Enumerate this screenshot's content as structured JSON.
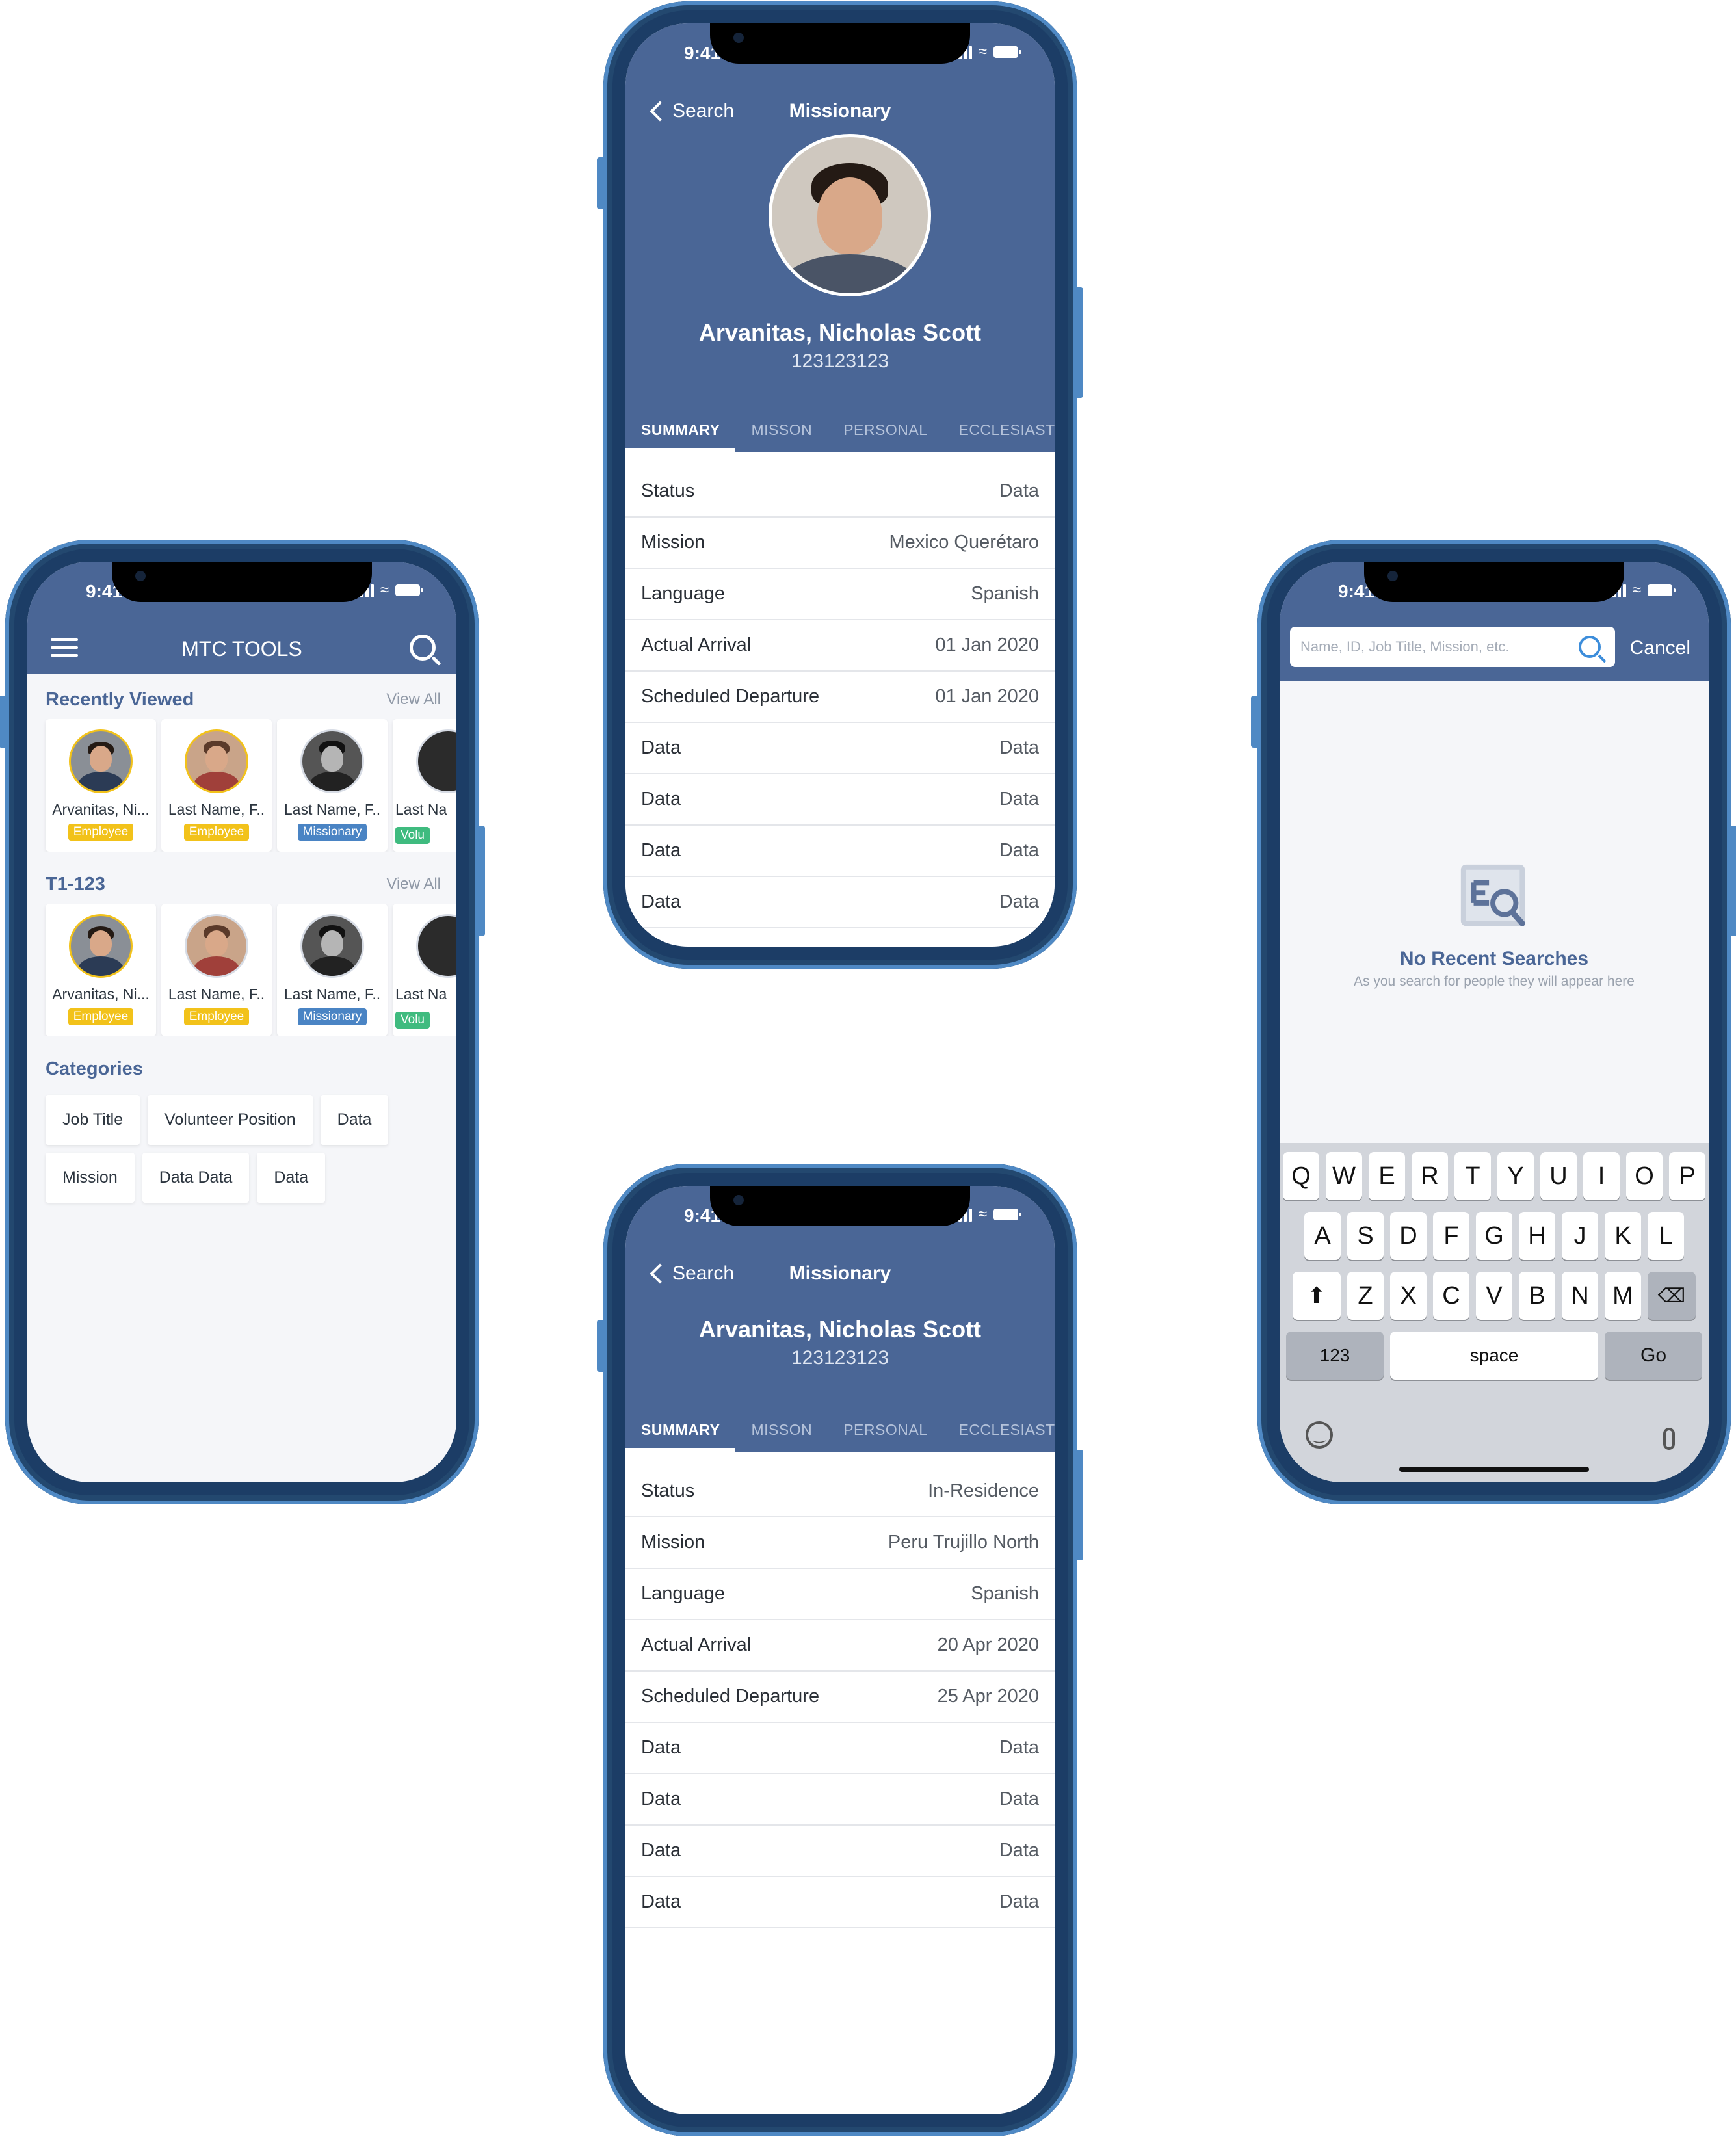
{
  "status": {
    "time": "9:41"
  },
  "colors": {
    "nav_blue": "#4a6696",
    "employee": "#f2c21a",
    "missionary": "#4a84c4",
    "volunteer": "#3fbb7f",
    "search_accent": "#3c8ddb"
  },
  "home": {
    "title": "MTC TOOLS",
    "recent": {
      "title": "Recently Viewed",
      "view_all": "View All",
      "cards": [
        {
          "name": "Arvanitas, Ni...",
          "badge": "Employee"
        },
        {
          "name": "Last Name, F..",
          "badge": "Employee"
        },
        {
          "name": "Last Name, F..",
          "badge": "Missionary"
        },
        {
          "name": "Last Na",
          "badge": "Volu"
        }
      ]
    },
    "group": {
      "title": "T1-123",
      "view_all": "View All",
      "cards": [
        {
          "name": "Arvanitas, Ni...",
          "badge": "Employee"
        },
        {
          "name": "Last Name, F..",
          "badge": "Employee"
        },
        {
          "name": "Last Name, F..",
          "badge": "Missionary"
        },
        {
          "name": "Last Na",
          "badge": "Volu"
        }
      ]
    },
    "categories": {
      "title": "Categories",
      "items": [
        "Job Title",
        "Volunteer Position",
        "Data",
        "Mission",
        "Data Data",
        "Data"
      ]
    }
  },
  "detail_a": {
    "back": "Search",
    "title": "Missionary",
    "name": "Arvanitas, Nicholas Scott",
    "id": "123123123",
    "tabs": [
      "SUMMARY",
      "MISSON",
      "PERSONAL",
      "ECCLESIASTI"
    ],
    "rows": [
      {
        "label": "Status",
        "value": "Data"
      },
      {
        "label": "Mission",
        "value": "Mexico Querétaro"
      },
      {
        "label": "Language",
        "value": "Spanish"
      },
      {
        "label": "Actual Arrival",
        "value": "01 Jan 2020"
      },
      {
        "label": "Scheduled Departure",
        "value": "01 Jan 2020"
      },
      {
        "label": "Data",
        "value": "Data"
      },
      {
        "label": "Data",
        "value": "Data"
      },
      {
        "label": "Data",
        "value": "Data"
      },
      {
        "label": "Data",
        "value": "Data"
      }
    ]
  },
  "detail_b": {
    "back": "Search",
    "title": "Missionary",
    "name": "Arvanitas, Nicholas Scott",
    "id": "123123123",
    "tabs": [
      "SUMMARY",
      "MISSON",
      "PERSONAL",
      "ECCLESIAST"
    ],
    "rows": [
      {
        "label": "Status",
        "value": "In-Residence"
      },
      {
        "label": "Mission",
        "value": "Peru Trujillo North"
      },
      {
        "label": "Language",
        "value": "Spanish"
      },
      {
        "label": "Actual Arrival",
        "value": "20 Apr 2020"
      },
      {
        "label": "Scheduled Departure",
        "value": "25 Apr 2020"
      },
      {
        "label": "Data",
        "value": "Data"
      },
      {
        "label": "Data",
        "value": "Data"
      },
      {
        "label": "Data",
        "value": "Data"
      },
      {
        "label": "Data",
        "value": "Data"
      }
    ]
  },
  "search": {
    "placeholder": "Name, ID, Job Title, Mission, etc.",
    "cancel": "Cancel",
    "empty_title": "No Recent Searches",
    "empty_sub": "As you search for people they will appear here",
    "keyboard": {
      "row1": [
        "Q",
        "W",
        "E",
        "R",
        "T",
        "Y",
        "U",
        "I",
        "O",
        "P"
      ],
      "row2": [
        "A",
        "S",
        "D",
        "F",
        "G",
        "H",
        "J",
        "K",
        "L"
      ],
      "row3": [
        "Z",
        "X",
        "C",
        "V",
        "B",
        "N",
        "M"
      ],
      "numbers": "123",
      "space": "space",
      "go": "Go"
    }
  }
}
